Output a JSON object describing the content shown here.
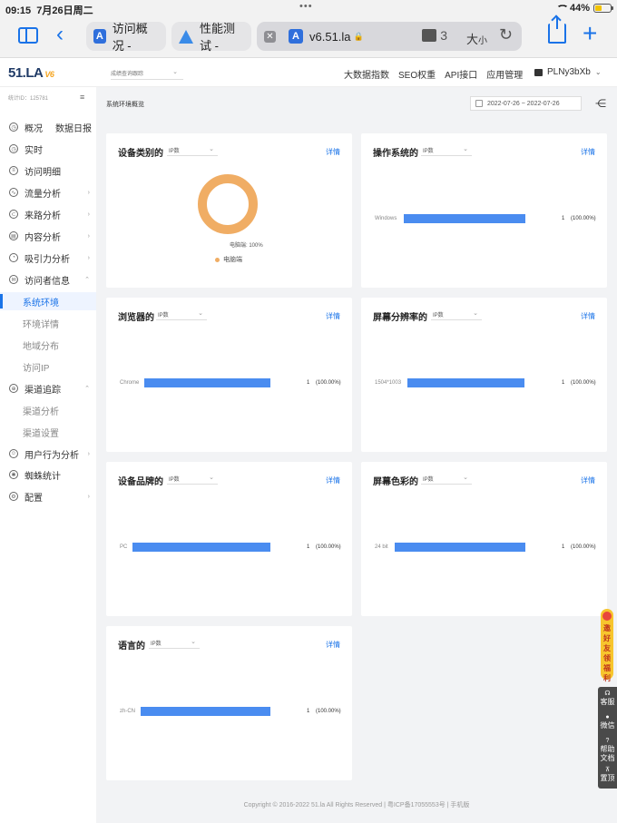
{
  "status_bar": {
    "time": "09:15",
    "date": "7月26日周二",
    "battery": "44%",
    "battery_level": 0.44
  },
  "browser": {
    "tabs": [
      {
        "label": "访问概况 -",
        "favicon": "A"
      },
      {
        "label": "性能测试 -",
        "favicon": "triangle"
      },
      {
        "label": "v6.51.la",
        "favicon": "A"
      }
    ],
    "extension_count": "3",
    "text_size_label": "大",
    "text_size_small": "小"
  },
  "header": {
    "logo": "51.LA",
    "logo_version": "V6",
    "site_select_placeholder": "成绩查询跟踪",
    "nav": [
      "大数据指数",
      "SEO权重",
      "API接口",
      "应用管理"
    ],
    "user": "PLNy3bXb"
  },
  "sidebar": {
    "stat_id": "统计ID：125781",
    "items": [
      {
        "label": "概况",
        "extra": "数据日报",
        "icon": "clock-icon"
      },
      {
        "label": "实时",
        "icon": "clock-icon"
      },
      {
        "label": "访问明细",
        "icon": "list-icon"
      },
      {
        "label": "流量分析",
        "icon": "chart-icon",
        "chevron": "›"
      },
      {
        "label": "来路分析",
        "icon": "route-icon",
        "chevron": "›"
      },
      {
        "label": "内容分析",
        "icon": "doc-icon",
        "chevron": "›"
      },
      {
        "label": "吸引力分析",
        "icon": "magnet-icon",
        "chevron": "›"
      },
      {
        "label": "访问者信息",
        "icon": "mail-icon",
        "chevron": "⌃"
      },
      {
        "label": "系统环境",
        "sub": true,
        "active": true
      },
      {
        "label": "环境详情",
        "sub": true
      },
      {
        "label": "地域分布",
        "sub": true
      },
      {
        "label": "访问IP",
        "sub": true
      },
      {
        "label": "渠道追踪",
        "icon": "target-icon",
        "chevron": "⌃"
      },
      {
        "label": "渠道分析",
        "sub": true
      },
      {
        "label": "渠道设置",
        "sub": true
      },
      {
        "label": "用户行为分析",
        "icon": "user-icon",
        "chevron": "›"
      },
      {
        "label": "蜘蛛统计",
        "icon": "spider-icon"
      },
      {
        "label": "配置",
        "icon": "gear-icon",
        "chevron": "›"
      }
    ]
  },
  "main": {
    "title": "系统环境概览",
    "date_range": "2022-07-26  ~  2022-07-26",
    "select_value": "IP数",
    "detail_label": "详情",
    "cards": [
      {
        "title": "设备类别的",
        "type": "donut",
        "slice_label": "电脑端: 100%",
        "legend": "电脑端"
      },
      {
        "title": "操作系统的",
        "type": "bar",
        "label": "Windows",
        "count": "1",
        "pct": "(100.00%)"
      },
      {
        "title": "浏览器的",
        "type": "bar",
        "label": "Chrome",
        "count": "1",
        "pct": "(100.00%)"
      },
      {
        "title": "屏幕分辨率的",
        "type": "bar",
        "label": "1504*1003",
        "count": "1",
        "pct": "(100.00%)"
      },
      {
        "title": "设备品牌的",
        "type": "bar",
        "label": "PC",
        "count": "1",
        "pct": "(100.00%)"
      },
      {
        "title": "屏幕色彩的",
        "type": "bar",
        "label": "24 bit",
        "count": "1",
        "pct": "(100.00%)"
      },
      {
        "title": "语言的",
        "type": "bar",
        "label": "zh-CN",
        "count": "1",
        "pct": "(100.00%)"
      }
    ],
    "footer": "Copyright © 2016-2022 51.la All Rights Reserved | 粤ICP备17055553号 | 手机版"
  },
  "float": {
    "invite": [
      "邀",
      "好",
      "友",
      "领",
      "福",
      "利"
    ],
    "tools": [
      {
        "label": "客服",
        "icon": "headset-icon"
      },
      {
        "label": "微信",
        "icon": "wechat-icon"
      },
      {
        "label": "帮助文档",
        "line1": "帮助",
        "line2": "文档",
        "icon": "help-icon"
      },
      {
        "label": "置顶",
        "icon": "top-icon"
      }
    ]
  }
}
